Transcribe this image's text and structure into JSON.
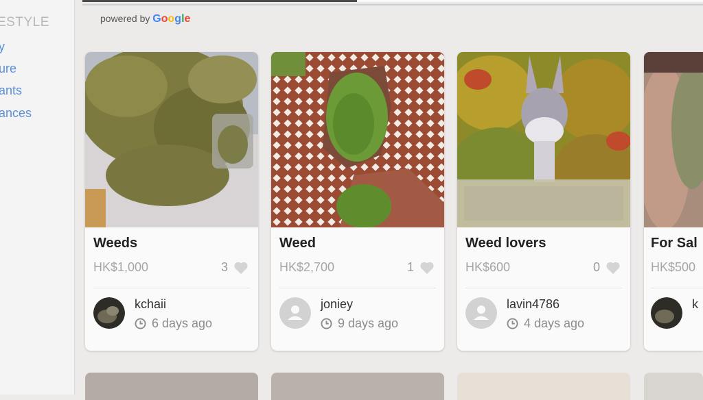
{
  "sidebar": {
    "title": "ESTYLE",
    "links": [
      "y",
      "ure",
      "ants",
      "ances"
    ]
  },
  "powered": {
    "prefix": "powered by",
    "brand": "Google"
  },
  "listings": [
    {
      "title": "Weeds",
      "price": "HK$1,000",
      "likes": "3",
      "seller": "kchaii",
      "time": "6 days ago",
      "avatar": "photo"
    },
    {
      "title": "Weed",
      "price": "HK$2,700",
      "likes": "1",
      "seller": "joniey",
      "time": "9 days ago",
      "avatar": "default"
    },
    {
      "title": "Weed lovers",
      "price": "HK$600",
      "likes": "0",
      "seller": "lavin4786",
      "time": "4 days ago",
      "avatar": "default"
    },
    {
      "title": "For Sal",
      "price": "HK$500",
      "likes": "",
      "seller": "k",
      "time": "",
      "avatar": "photo"
    }
  ],
  "colors": {
    "accent_link": "#5b8fd6",
    "price_gray": "#a6a6a6",
    "heart_gray": "#d0d0d0"
  },
  "icons": [
    "heart-icon",
    "clock-icon",
    "default-avatar-icon"
  ]
}
